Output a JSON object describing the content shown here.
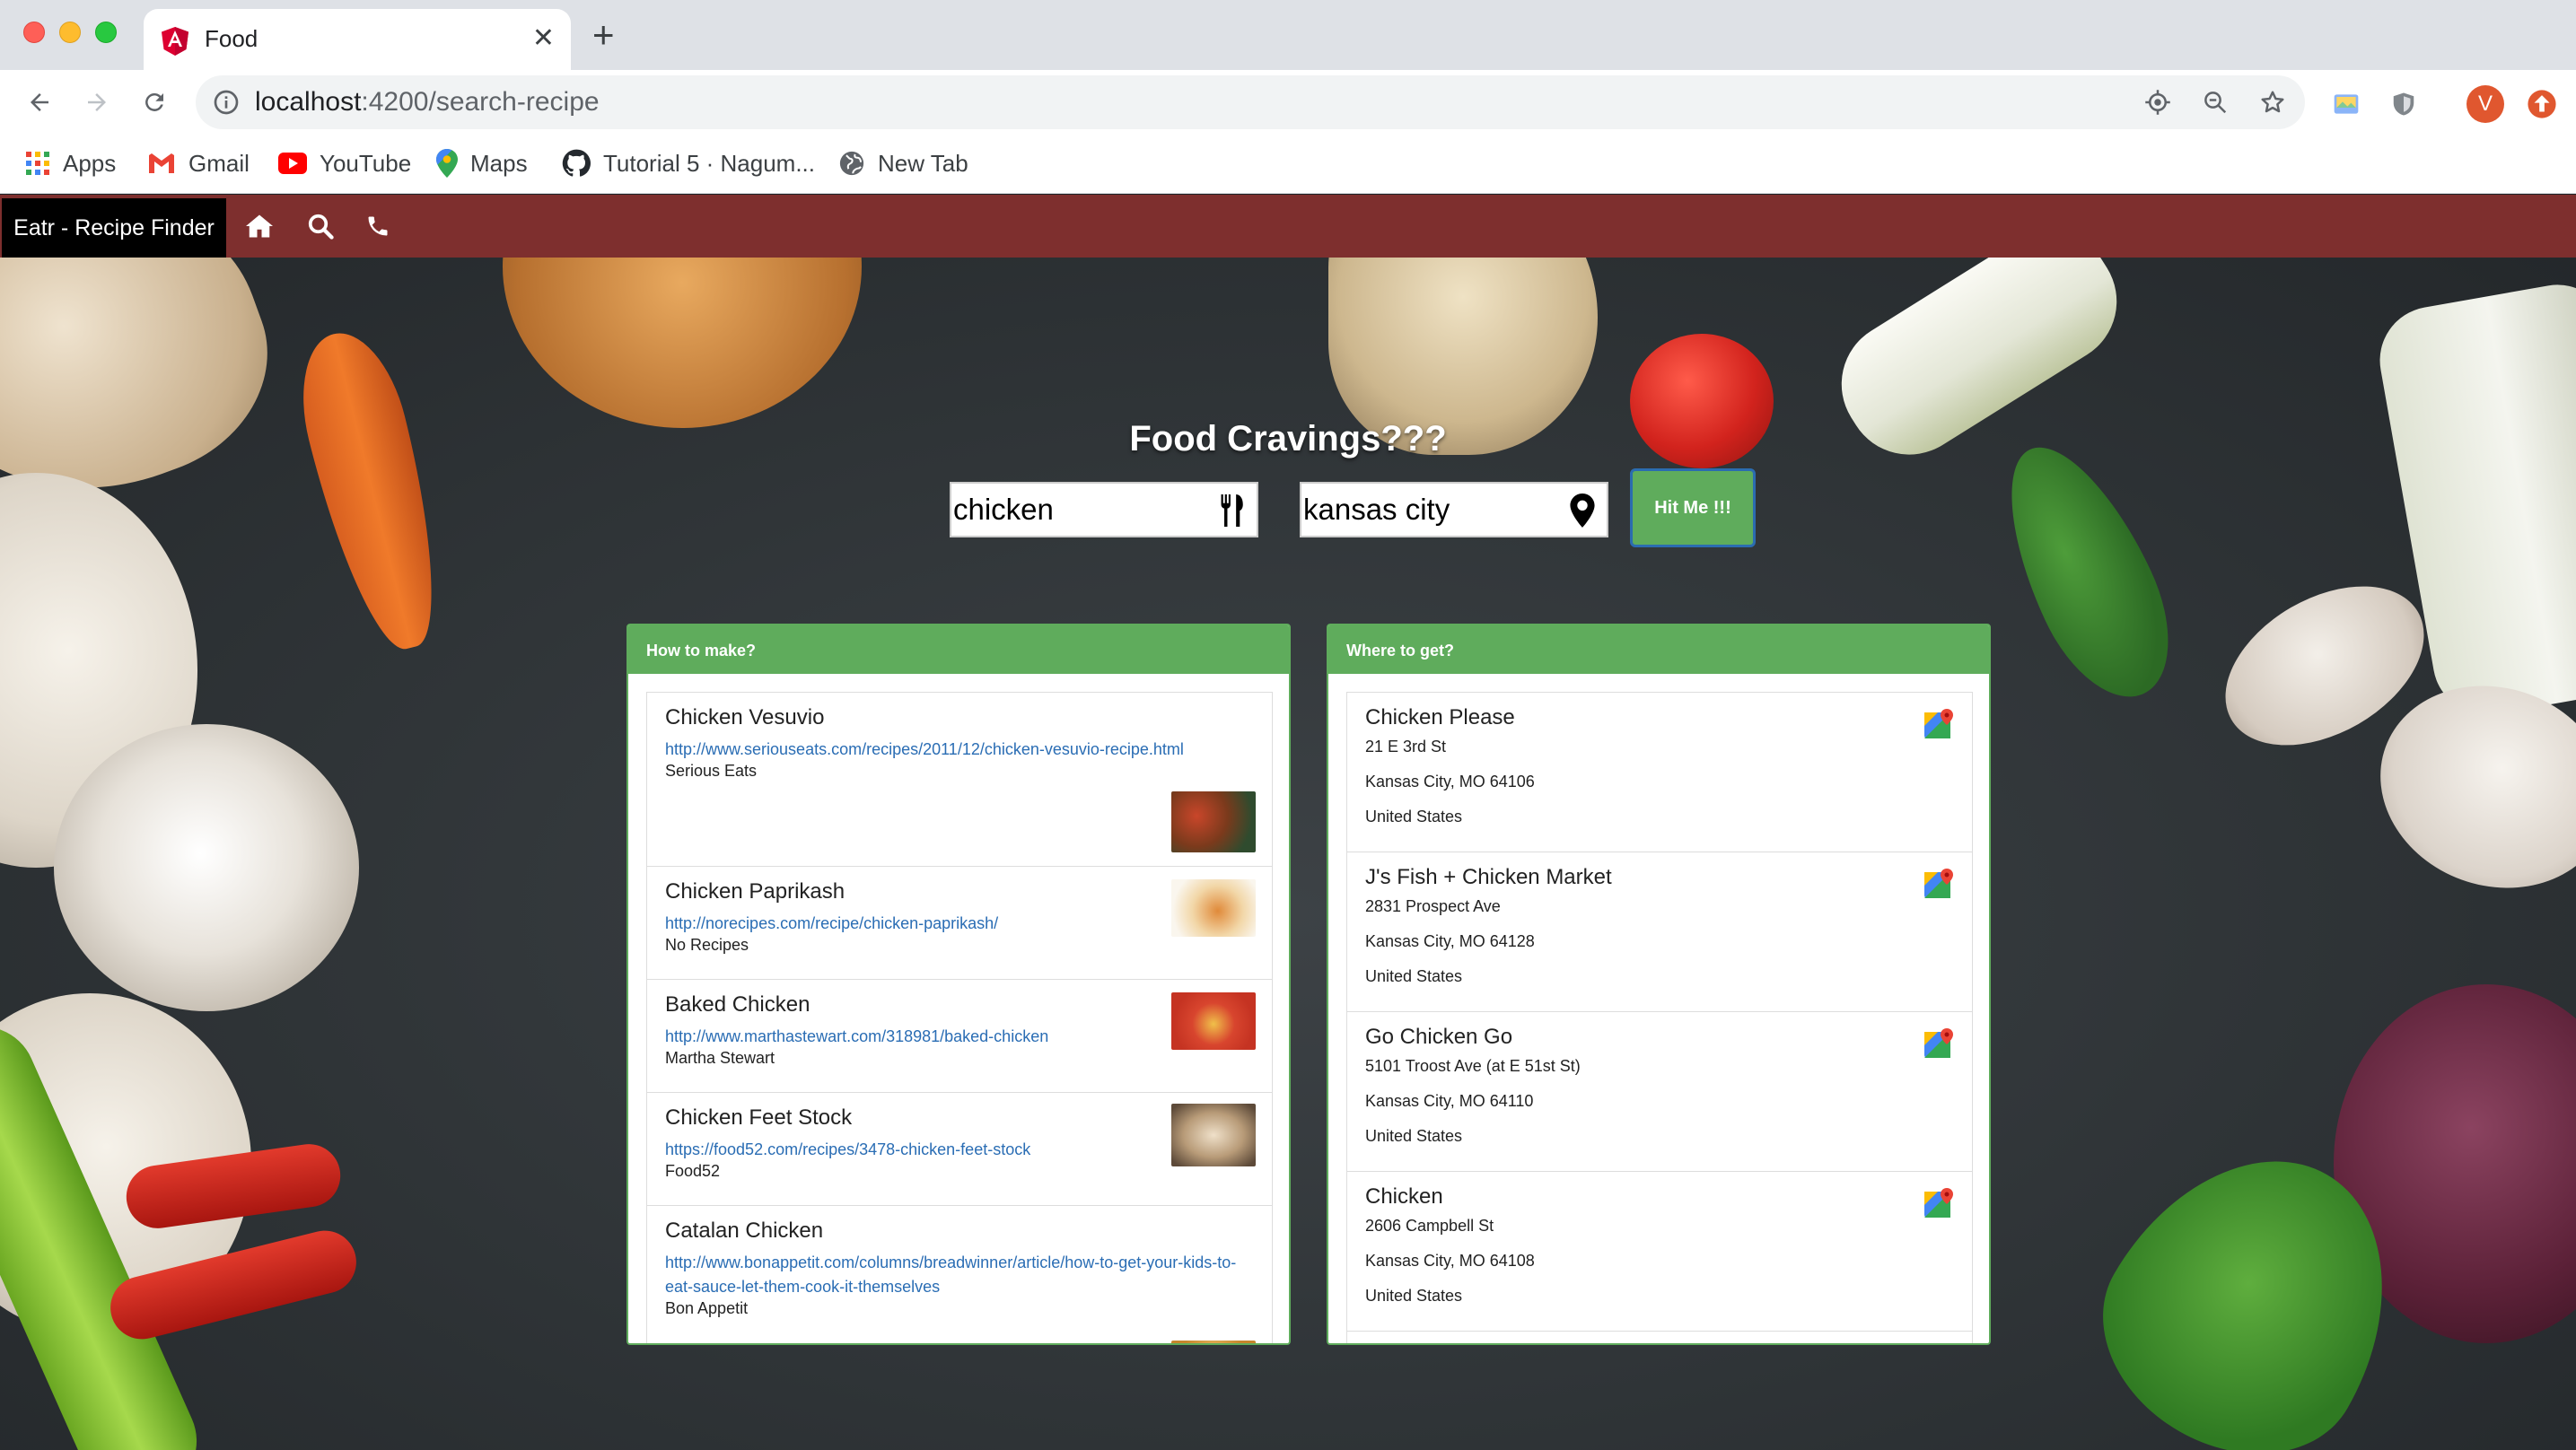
{
  "browser": {
    "tab_title": "Food",
    "url_host": "localhost",
    "url_path": ":4200/search-recipe",
    "avatar_letter": "V",
    "bookmarks": [
      {
        "label": "Apps",
        "icon": "apps-grid-icon"
      },
      {
        "label": "Gmail",
        "icon": "gmail-icon"
      },
      {
        "label": "YouTube",
        "icon": "youtube-icon"
      },
      {
        "label": "Maps",
        "icon": "maps-icon"
      },
      {
        "label": "Tutorial 5 · Nagum...",
        "icon": "github-icon"
      },
      {
        "label": "New Tab",
        "icon": "globe-icon"
      }
    ]
  },
  "app": {
    "brand": "Eatr - Recipe Finder",
    "nav_icons": [
      "home-icon",
      "search-icon",
      "phone-icon"
    ],
    "colors": {
      "navbar": "#7e2f2e",
      "accent_green": "#5fac5c",
      "link": "#2a6db4"
    }
  },
  "search": {
    "headline": "Food Cravings???",
    "food_value": "chicken",
    "location_value": "kansas city",
    "button_label": "Hit Me !!!"
  },
  "recipes": {
    "header": "How to make?",
    "items": [
      {
        "name": "Chicken Vesuvio",
        "url": "http://www.seriouseats.com/recipes/2011/12/chicken-vesuvio-recipe.html",
        "source": "Serious Eats"
      },
      {
        "name": "Chicken Paprikash",
        "url": "http://norecipes.com/recipe/chicken-paprikash/",
        "source": "No Recipes"
      },
      {
        "name": "Baked Chicken",
        "url": "http://www.marthastewart.com/318981/baked-chicken",
        "source": "Martha Stewart"
      },
      {
        "name": "Chicken Feet Stock",
        "url": "https://food52.com/recipes/3478-chicken-feet-stock",
        "source": "Food52"
      },
      {
        "name": "Catalan Chicken",
        "url": "http://www.bonappetit.com/columns/breadwinner/article/how-to-get-your-kids-to-eat-sauce-let-them-cook-it-themselves",
        "source": "Bon Appetit"
      }
    ]
  },
  "places": {
    "header": "Where to get?",
    "items": [
      {
        "name": "Chicken Please",
        "street": "21 E 3rd St",
        "city": "Kansas City, MO 64106",
        "country": "United States"
      },
      {
        "name": "J's Fish + Chicken Market",
        "street": "2831 Prospect Ave",
        "city": "Kansas City, MO 64128",
        "country": "United States"
      },
      {
        "name": "Go Chicken Go",
        "street": "5101 Troost Ave (at E 51st St)",
        "city": "Kansas City, MO 64110",
        "country": "United States"
      },
      {
        "name": "Chicken",
        "street": "2606 Campbell St",
        "city": "Kansas City, MO 64108",
        "country": "United States"
      }
    ]
  }
}
